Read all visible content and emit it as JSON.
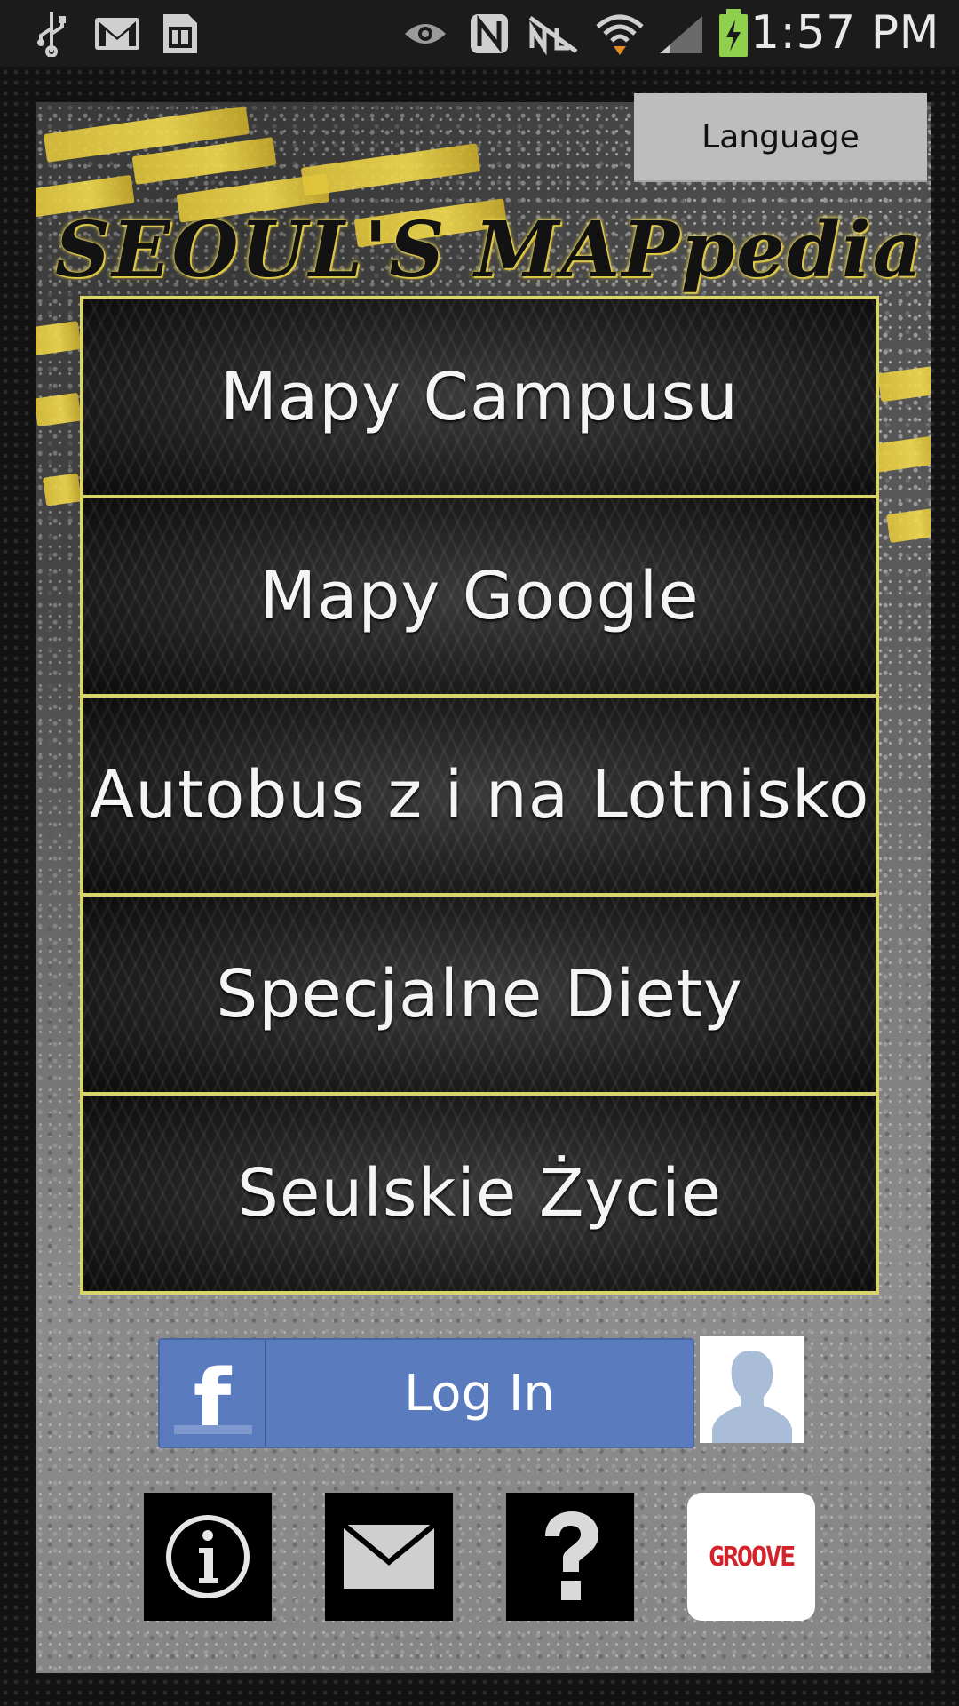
{
  "status_bar": {
    "time": "1:57 PM",
    "icons": [
      "usb-icon",
      "gmail-icon",
      "sim-card-icon",
      "eye-icon",
      "nfc-icon",
      "mute-icon",
      "wifi-icon",
      "signal-icon",
      "battery-icon"
    ]
  },
  "app": {
    "logo_text": "SEOUL'S MAPpedia",
    "language_button": "Language"
  },
  "menu": {
    "items": [
      {
        "label": "Mapy Campusu"
      },
      {
        "label": "Mapy Google"
      },
      {
        "label": "Autobus z i na Lotnisko"
      },
      {
        "label": "Specjalne Diety"
      },
      {
        "label": "Seulskie Życie"
      }
    ]
  },
  "facebook": {
    "logo": "f",
    "login_label": "Log In"
  },
  "bottom_icons": {
    "info": "info-icon",
    "mail": "mail-icon",
    "help": "help-icon",
    "groove_label": "GROOVE"
  },
  "colors": {
    "accent_border": "#d9d56a",
    "facebook_blue": "#5b7bbf",
    "groove_red": "#d2232a"
  }
}
